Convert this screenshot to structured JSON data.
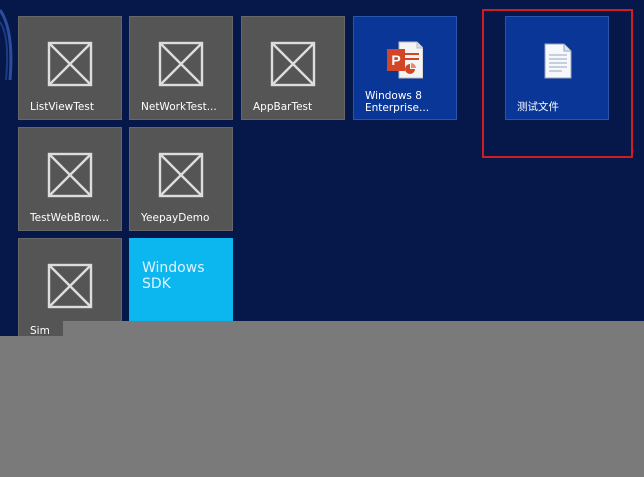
{
  "tiles": [
    {
      "label": "ListViewTest",
      "icon": "placeholder-app-icon"
    },
    {
      "label": "NetWorkTest...",
      "icon": "placeholder-app-icon"
    },
    {
      "label": "AppBarTest",
      "icon": "placeholder-app-icon"
    },
    {
      "label": "Windows 8\nEnterprise...",
      "icon": "powerpoint-icon"
    },
    {
      "label": "测试文件",
      "icon": "document-icon"
    },
    {
      "label": "TestWebBrow...",
      "icon": "placeholder-app-icon"
    },
    {
      "label": "YeepayDemo",
      "icon": "placeholder-app-icon"
    },
    {
      "label": "Sim",
      "icon": "placeholder-app-icon"
    },
    {
      "label": "Windows\nSDK",
      "icon": "none"
    }
  ],
  "colors": {
    "background": "#06184a",
    "tile_gray": "#555555",
    "tile_blue": "#0a3797",
    "tile_cyan": "#0cb6ef",
    "highlight": "#d21b22",
    "overlay": "#7a7a7a"
  }
}
